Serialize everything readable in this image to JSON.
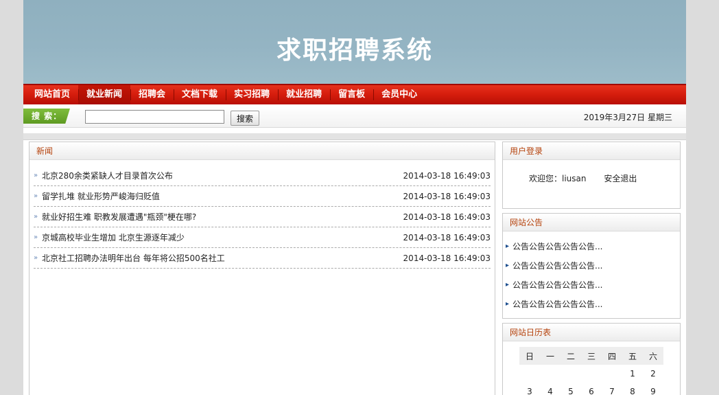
{
  "site": {
    "title": "求职招聘系统"
  },
  "nav": [
    {
      "label": "网站首页"
    },
    {
      "label": "就业新闻"
    },
    {
      "label": "招聘会"
    },
    {
      "label": "文档下载"
    },
    {
      "label": "实习招聘"
    },
    {
      "label": "就业招聘"
    },
    {
      "label": "留言板"
    },
    {
      "label": "会员中心"
    }
  ],
  "search": {
    "tag": "搜 索：",
    "button": "搜索",
    "value": ""
  },
  "date": "2019年3月27日 星期三",
  "news": {
    "header": "新闻",
    "items": [
      {
        "title": "北京280余类紧缺人才目录首次公布",
        "date": "2014-03-18 16:49:03"
      },
      {
        "title": "留学扎堆 就业形势严峻海归贬值",
        "date": "2014-03-18 16:49:03"
      },
      {
        "title": "就业好招生难 职教发展遭遇\"瓶颈\"梗在哪?",
        "date": "2014-03-18 16:49:03"
      },
      {
        "title": "京城高校毕业生增加 北京生源逐年减少",
        "date": "2014-03-18 16:49:03"
      },
      {
        "title": "北京社工招聘办法明年出台 每年将公招500名社工",
        "date": "2014-03-18 16:49:03"
      }
    ]
  },
  "login": {
    "header": "用户登录",
    "welcome": "欢迎您：liusan",
    "logout": "安全退出"
  },
  "notice": {
    "header": "网站公告",
    "items": [
      "公告公告公告公告公告...",
      "公告公告公告公告公告...",
      "公告公告公告公告公告...",
      "公告公告公告公告公告..."
    ]
  },
  "calendar": {
    "header": "网站日历表",
    "weekdays": [
      "日",
      "一",
      "二",
      "三",
      "四",
      "五",
      "六"
    ],
    "rows": [
      [
        "",
        "",
        "",
        "",
        "",
        "1",
        "2"
      ],
      [
        "3",
        "4",
        "5",
        "6",
        "7",
        "8",
        "9"
      ]
    ]
  }
}
